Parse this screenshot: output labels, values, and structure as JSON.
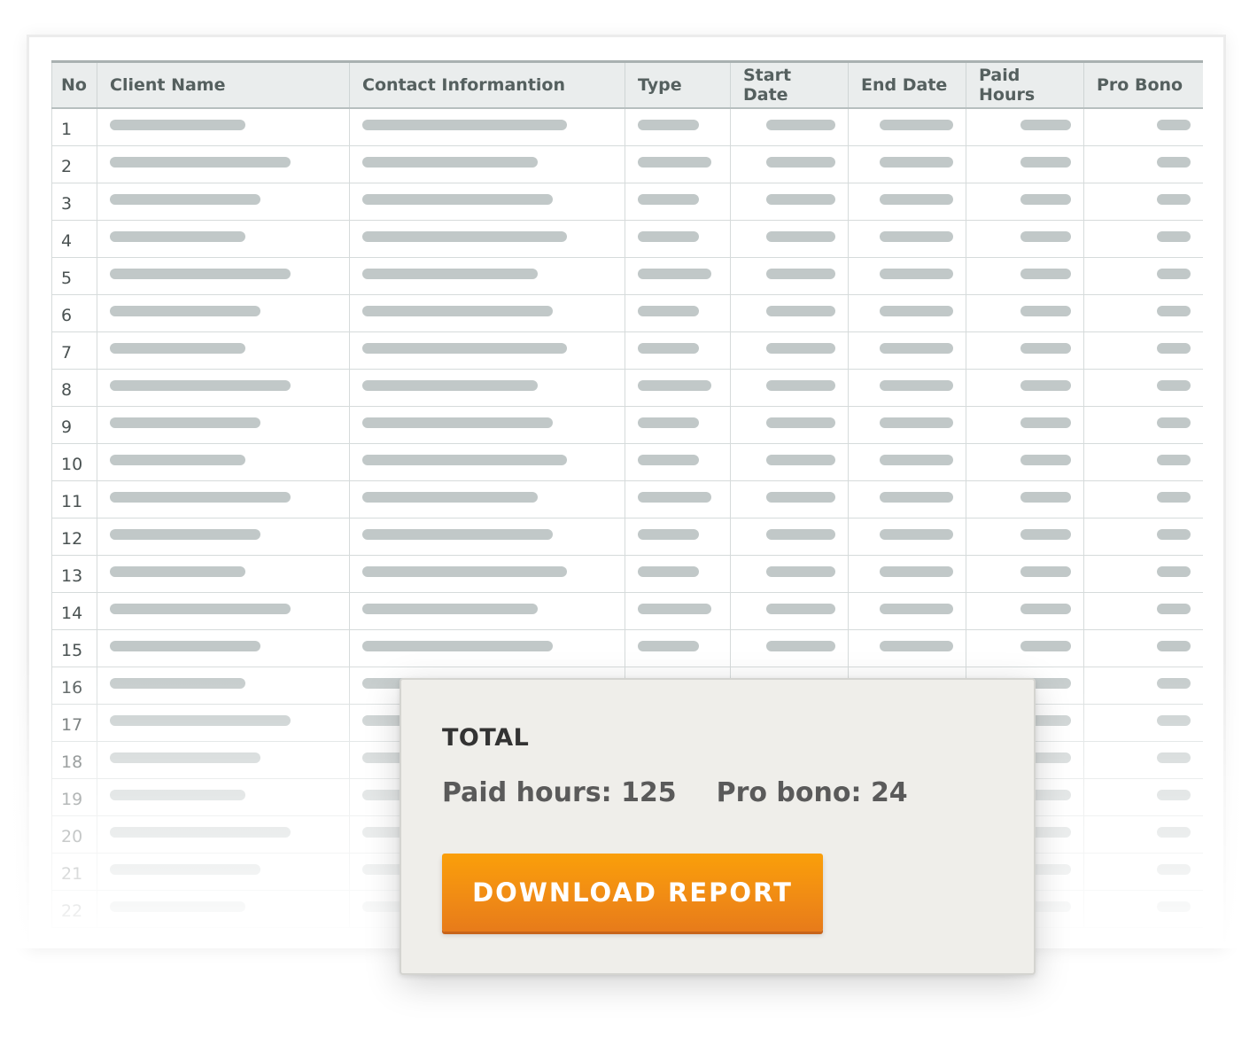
{
  "table": {
    "headers": [
      "No",
      "Client Name",
      "Contact Informantion",
      "Type",
      "Start Date",
      "End Date",
      "Paid Hours",
      "Pro Bono"
    ],
    "row_numbers": [
      "1",
      "2",
      "3",
      "4",
      "5",
      "6",
      "7",
      "8",
      "9",
      "10",
      "11",
      "12",
      "13",
      "14",
      "15",
      "16",
      "17",
      "18",
      "19",
      "20",
      "21",
      "22"
    ]
  },
  "summary": {
    "title": "TOTAL",
    "paid_hours_label": "Paid hours:",
    "paid_hours_value": "125",
    "pro_bono_label": "Pro bono:",
    "pro_bono_value": "24",
    "button_label": "DOWNLOAD REPORT"
  },
  "colors": {
    "header_bg": "#eaeded",
    "placeholder_bar": "#c1c8c8",
    "button_orange": "#f08a15",
    "popup_bg": "#efeeea"
  }
}
